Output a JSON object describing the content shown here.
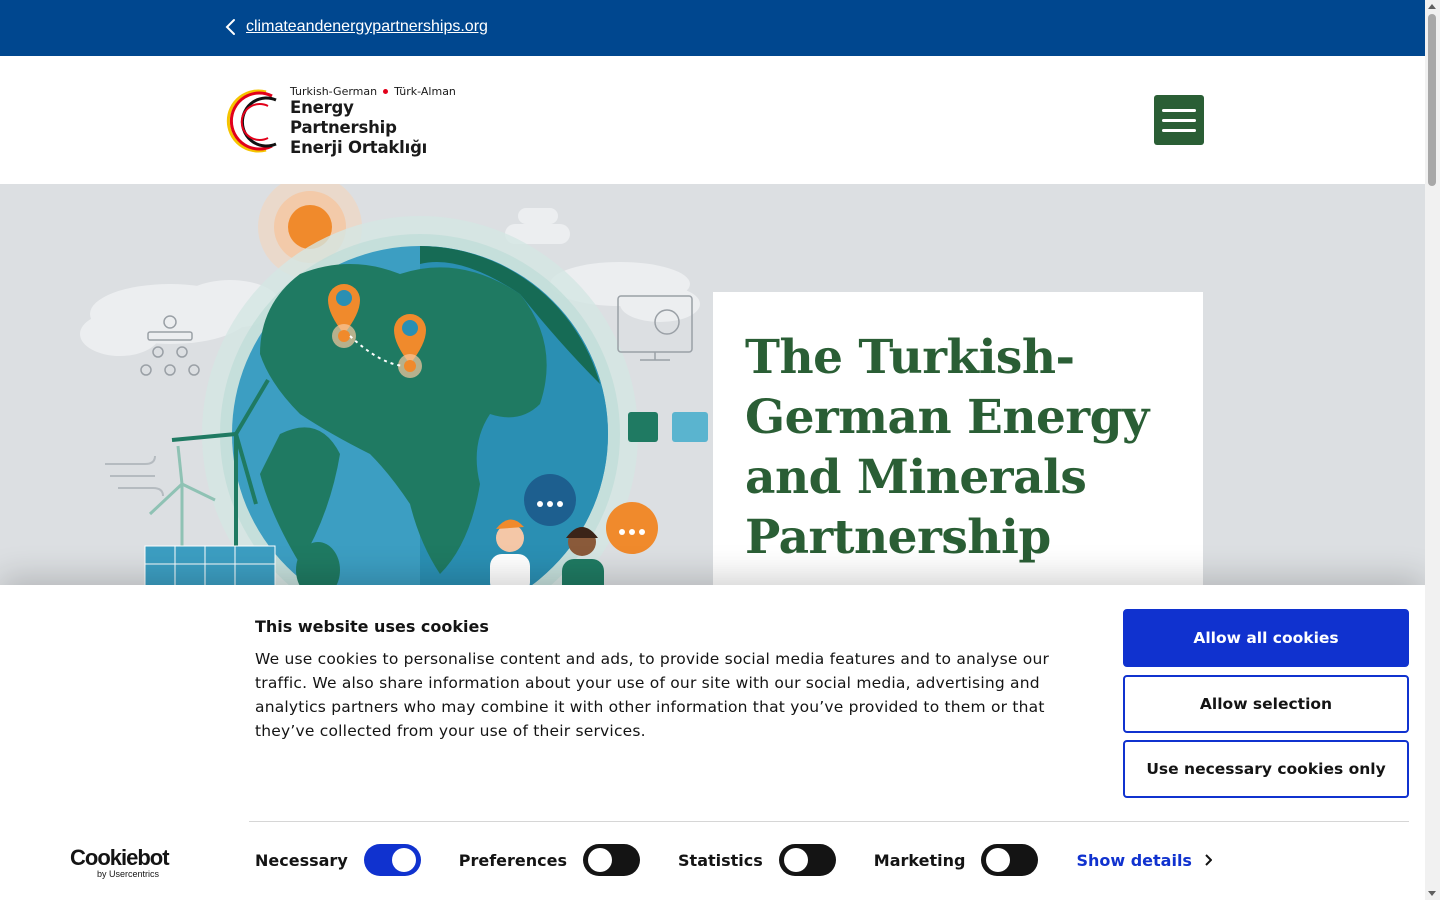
{
  "topbar": {
    "back_link": "climateandenergypartnerships.org"
  },
  "header": {
    "logo": {
      "line1_left": "Turkish-German",
      "line1_right": "Türk-Alman",
      "line2": "Energy Partnership",
      "line3": "Enerji Ortaklığı"
    }
  },
  "hero": {
    "title": "The Turkish-German Energy and Minerals Partnership"
  },
  "cookie": {
    "heading": "This website uses cookies",
    "body": "We use cookies to personalise content and ads, to provide social media features and to analyse our traffic. We also share information about your use of our site with our social media, advertising and analytics partners who may combine it with other information that you’ve provided to them or that they’ve collected from your use of their services.",
    "buttons": {
      "allow_all": "Allow all cookies",
      "allow_selection": "Allow selection",
      "necessary_only": "Use necessary cookies only"
    },
    "brand": {
      "name": "Cookiebot",
      "sub": "by Usercentrics"
    },
    "toggles": [
      {
        "label": "Necessary",
        "on": true
      },
      {
        "label": "Preferences",
        "on": false
      },
      {
        "label": "Statistics",
        "on": false
      },
      {
        "label": "Marketing",
        "on": false
      }
    ],
    "show_details": "Show details"
  },
  "colors": {
    "topbar": "#00478f",
    "brand_green": "#2a5e35",
    "cookie_blue": "#1032cf",
    "hero_bg": "#dcdfe2"
  }
}
